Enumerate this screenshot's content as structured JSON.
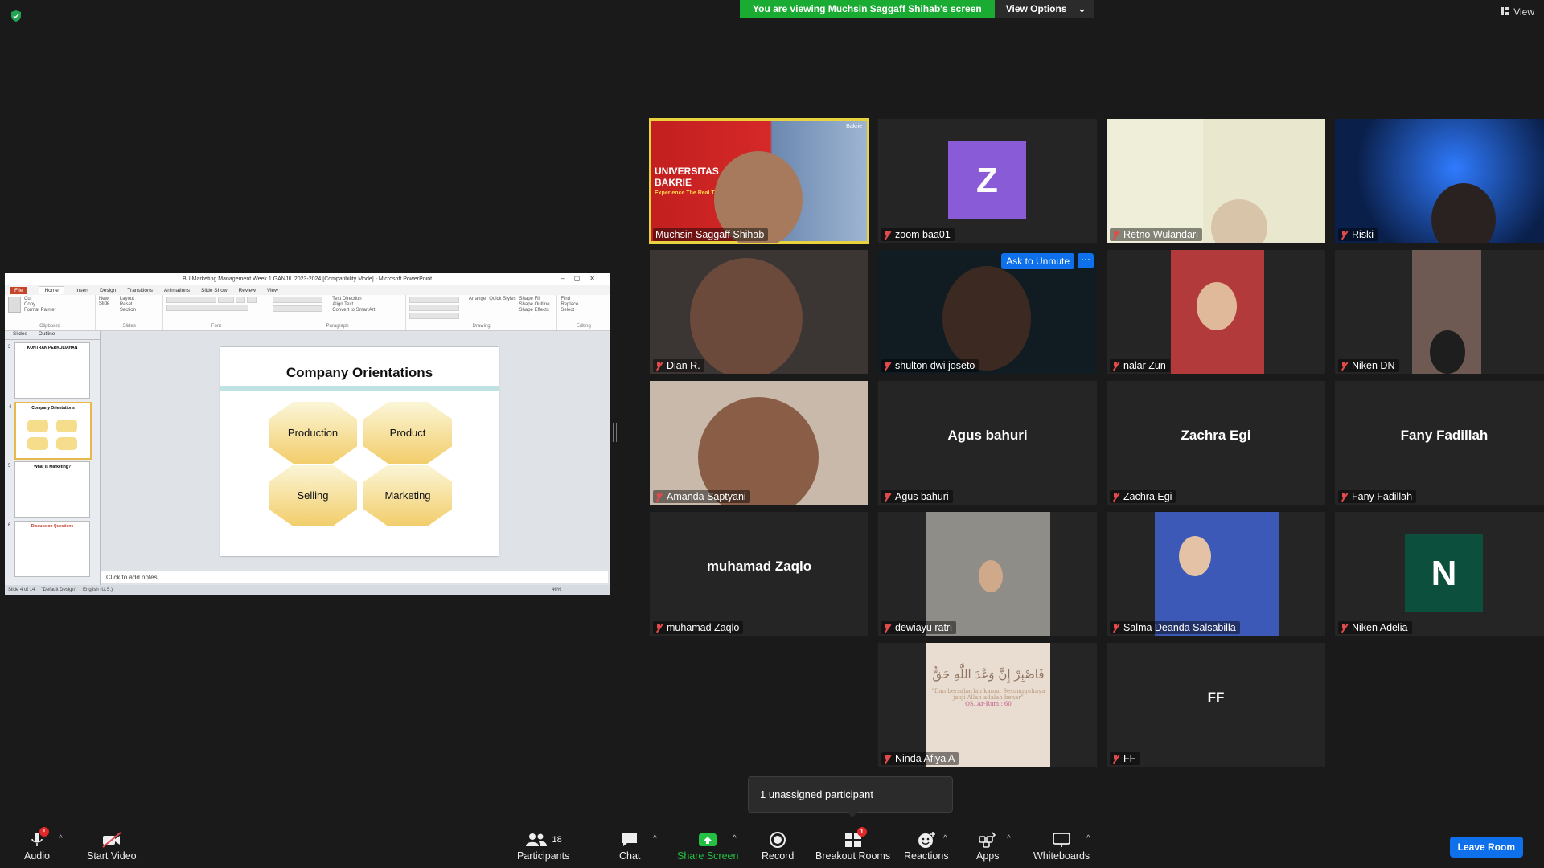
{
  "banner": {
    "viewing": "You are viewing Muchsin Saggaff Shihab's screen",
    "view_options": "View Options"
  },
  "view_button": "View",
  "share": {
    "window_title": "BU Marketing Management Week 1 GANJIL 2023-2024 [Compatibility Mode] - Microsoft PowerPoint",
    "tabs": [
      "File",
      "Home",
      "Insert",
      "Design",
      "Transitions",
      "Animations",
      "Slide Show",
      "Review",
      "View"
    ],
    "ribbon_groups": [
      "Clipboard",
      "Slides",
      "Font",
      "Paragraph",
      "Drawing",
      "Editing"
    ],
    "ribbon_labels": {
      "paste": "Paste",
      "cut": "Cut",
      "copy": "Copy",
      "format_painter": "Format Painter",
      "new_slide": "New Slide",
      "layout": "Layout",
      "reset": "Reset",
      "section": "Section",
      "text_direction": "Text Direction",
      "align_text": "Align Text",
      "convert": "Convert to SmartArt",
      "arrange": "Arrange",
      "quick_styles": "Quick Styles",
      "shape_fill": "Shape Fill",
      "shape_outline": "Shape Outline",
      "shape_effects": "Shape Effects",
      "find": "Find",
      "replace": "Replace",
      "select": "Select"
    },
    "pane_tabs": [
      "Slides",
      "Outline"
    ],
    "thumbs": [
      {
        "num": "3",
        "title": "KONTRAK PERKULIAHAN"
      },
      {
        "num": "4",
        "title": "Company Orientations"
      },
      {
        "num": "5",
        "title": "What is Marketing?"
      },
      {
        "num": "6",
        "title": "Discussion Questions"
      }
    ],
    "slide": {
      "title": "Company Orientations",
      "shapes": [
        "Production",
        "Product",
        "Selling",
        "Marketing"
      ]
    },
    "notes": "Click to add notes",
    "status": {
      "slide": "Slide 4 of 14",
      "theme": "\"Default Design\"",
      "language": "English (U.S.)",
      "zoom": "46%"
    }
  },
  "participants": [
    {
      "name": "Muchsin Saggaff Shihab",
      "kind": "video",
      "speaking": true
    },
    {
      "name": "zoom baa01",
      "kind": "avatar",
      "initial": "Z",
      "color": "#8a5bd6"
    },
    {
      "name": "Retno Wulandari",
      "kind": "video"
    },
    {
      "name": "Riski",
      "kind": "video"
    },
    {
      "name": "Dian R.",
      "kind": "video"
    },
    {
      "name": "shulton dwi joseto",
      "kind": "video"
    },
    {
      "name": "nalar Zun",
      "kind": "video"
    },
    {
      "name": "Niken DN",
      "kind": "video"
    },
    {
      "name": "Amanda Saptyani",
      "kind": "video"
    },
    {
      "name": "Agus bahuri",
      "kind": "name"
    },
    {
      "name": "Zachra Egi",
      "kind": "name"
    },
    {
      "name": "Fany Fadillah",
      "kind": "name"
    },
    {
      "name": "muhamad Zaqlo",
      "kind": "name"
    },
    {
      "name": "dewiayu ratri",
      "kind": "video"
    },
    {
      "name": "Salma Deanda Salsabilla",
      "kind": "video"
    },
    {
      "name": "Niken Adelia",
      "kind": "avatar",
      "initial": "N",
      "color": "#0b4f3c"
    },
    {
      "name": "Ninda Afiya A",
      "kind": "video"
    },
    {
      "name": "FF",
      "kind": "name"
    }
  ],
  "speaker_overlay": {
    "line1": "UNIVERSITAS",
    "line2": "BAKRIE",
    "line3": "Experience The Real Thing",
    "logo": "Bakrie"
  },
  "ninda_overlay": {
    "arabic": "فَاصْبِرْ إِنَّ وَعْدَ اللَّهِ حَقٌّ",
    "line1": "\"Dan bersabarlah kamu, Sesungguhnya",
    "line2": "janji Allah adalah benar\"",
    "line3": "QS. Ar-Rum : 60"
  },
  "ask_to_unmute": "Ask to Unmute",
  "more_glyph": "···",
  "unassigned": "1 unassigned participant",
  "toolbar": {
    "audio": "Audio",
    "start_video": "Start Video",
    "participants": "Participants",
    "participants_count": "18",
    "chat": "Chat",
    "share_screen": "Share Screen",
    "record": "Record",
    "breakout_rooms": "Breakout Rooms",
    "breakout_badge": "1",
    "audio_badge": "!",
    "reactions": "Reactions",
    "apps": "Apps",
    "whiteboards": "Whiteboards",
    "leave": "Leave Room"
  },
  "colors": {
    "share_green": "#1aab33",
    "blue": "#0e71eb",
    "speaker_border": "#e8d33f",
    "muted_red": "#e34b4b"
  }
}
